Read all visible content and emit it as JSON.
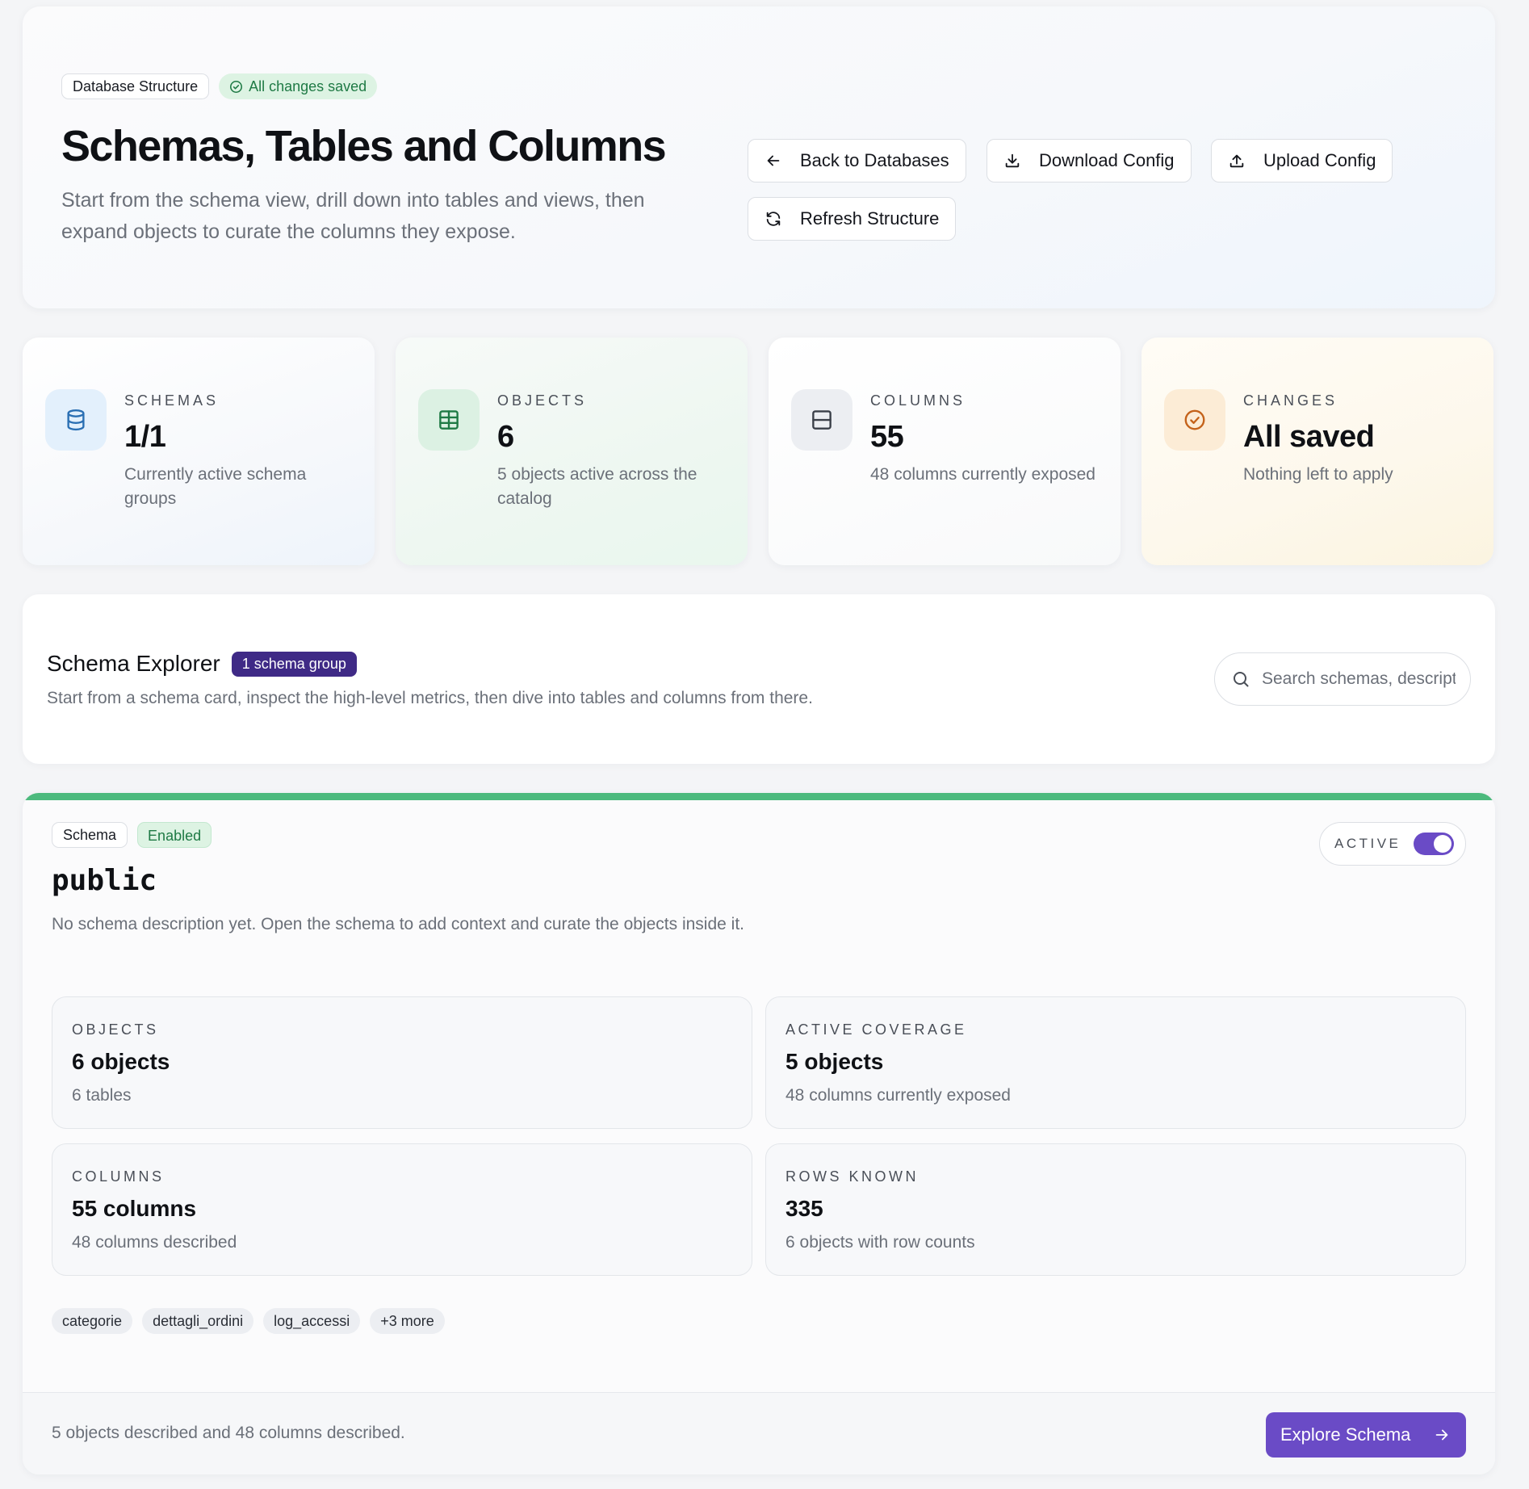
{
  "header": {
    "section_badge": "Database Structure",
    "saved_badge": "All changes saved",
    "title": "Schemas, Tables and Columns",
    "description": "Start from the schema view, drill down into tables and views, then expand objects to curate the columns they expose.",
    "buttons": {
      "back": "Back to Databases",
      "download": "Download Config",
      "upload": "Upload Config",
      "refresh": "Refresh Structure"
    }
  },
  "stats": [
    {
      "label": "SCHEMAS",
      "value": "1/1",
      "desc": "Currently active schema groups",
      "icon": "database-icon"
    },
    {
      "label": "OBJECTS",
      "value": "6",
      "desc": "5 objects active across the catalog",
      "icon": "table-icon"
    },
    {
      "label": "COLUMNS",
      "value": "55",
      "desc": "48 columns currently exposed",
      "icon": "columns-icon"
    },
    {
      "label": "CHANGES",
      "value": "All saved",
      "desc": "Nothing left to apply",
      "icon": "check-circle-icon"
    }
  ],
  "explorer": {
    "title": "Schema Explorer",
    "badge": "1 schema group",
    "description": "Start from a schema card, inspect the high-level metrics, then dive into tables and columns from there.",
    "search_placeholder": "Search schemas, descriptions"
  },
  "schema": {
    "type_badge": "Schema",
    "status_badge": "Enabled",
    "name": "public",
    "description": "No schema description yet. Open the schema to add context and curate the objects inside it.",
    "active_label": "ACTIVE",
    "active": true,
    "metrics": [
      {
        "label": "OBJECTS",
        "value": "6 objects",
        "sub": "6 tables"
      },
      {
        "label": "ACTIVE COVERAGE",
        "value": "5 objects",
        "sub": "48 columns currently exposed"
      },
      {
        "label": "COLUMNS",
        "value": "55 columns",
        "sub": "48 columns described"
      },
      {
        "label": "ROWS KNOWN",
        "value": "335",
        "sub": "6 objects with row counts"
      }
    ],
    "tables": [
      "categorie",
      "dettagli_ordini",
      "log_accessi",
      "+3 more"
    ],
    "footer_text": "5 objects described and 48 columns described.",
    "explore_button": "Explore Schema"
  },
  "colors": {
    "accent": "#6a4bc6",
    "enabled_green": "#4cba7d",
    "explorer_badge": "#3f2a86"
  }
}
